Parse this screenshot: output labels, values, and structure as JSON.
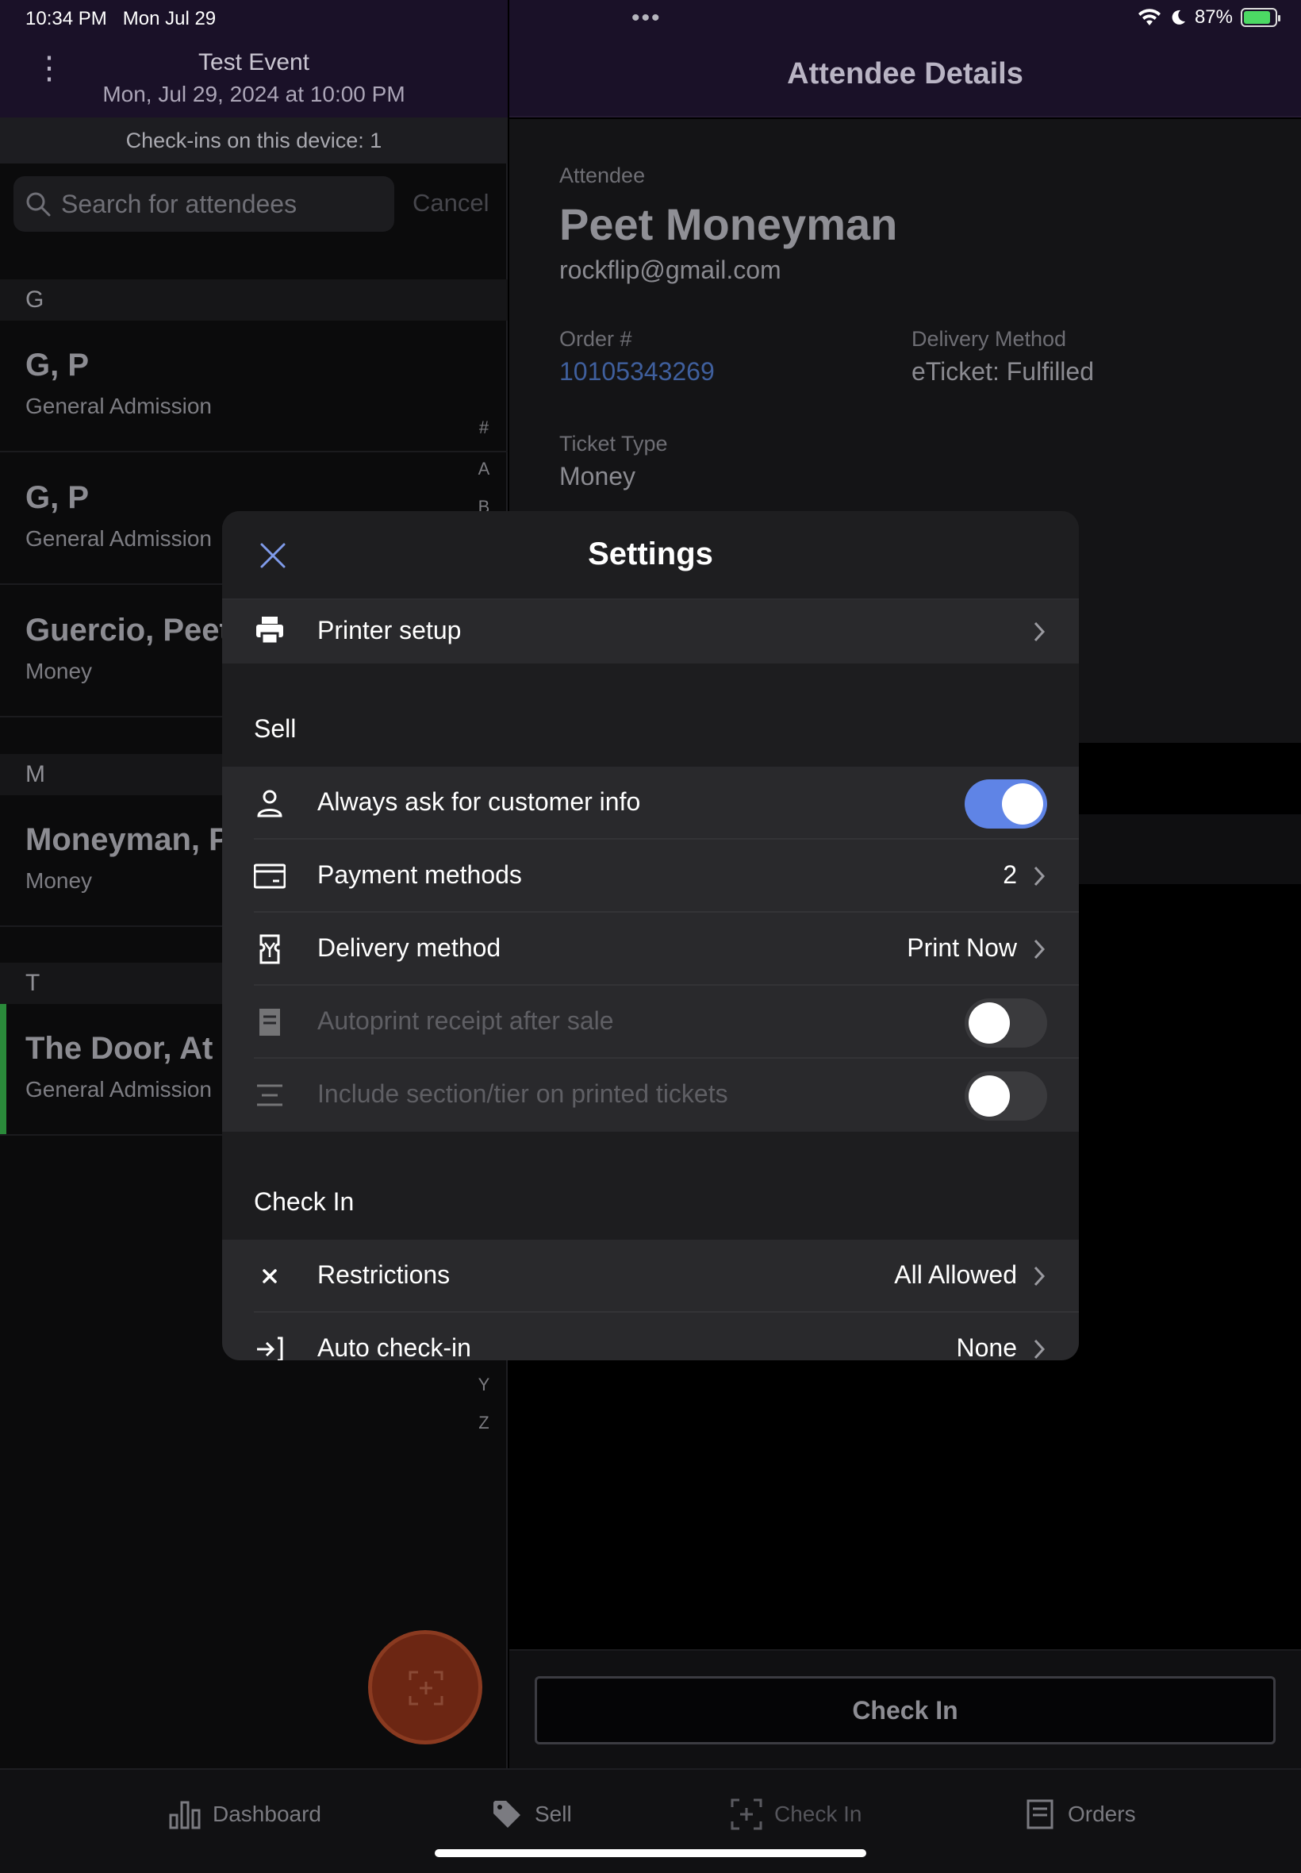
{
  "status_bar": {
    "time": "10:34 PM",
    "date": "Mon Jul 29",
    "dots": "•••",
    "battery": "87%",
    "battery_level": 0.87,
    "icons": [
      "wifi-icon",
      "moon-icon",
      "battery-charging-icon"
    ]
  },
  "event": {
    "title": "Test Event",
    "date": "Mon, Jul 29, 2024 at 10:00 PM",
    "checkins": "Check-ins on this device: 1"
  },
  "search": {
    "placeholder": "Search for attendees",
    "cancel": "Cancel"
  },
  "attendee_list": {
    "sections": [
      "G",
      "M",
      "T"
    ],
    "items": [
      {
        "name": "G, P",
        "ticket": "General Admission"
      },
      {
        "name": "G, P",
        "ticket": "General Admission"
      },
      {
        "name": "Guercio, Peet",
        "ticket": "Money"
      },
      {
        "name": "Moneyman, Pe",
        "ticket": "Money"
      },
      {
        "name": "The Door, At",
        "ticket": "General Admission"
      }
    ],
    "index_visible": [
      "#",
      "A",
      "B",
      "Y",
      "Z"
    ]
  },
  "details": {
    "header": "Attendee Details",
    "attendee_label": "Attendee",
    "name": "Peet Moneyman",
    "email": "rockflip@gmail.com",
    "order_label": "Order #",
    "order_number": "10105343269",
    "delivery_label": "Delivery Method",
    "delivery_value": "eTicket: Fulfilled",
    "ticket_type_label": "Ticket Type",
    "ticket_type_value": "Money",
    "check_in_button": "Check In"
  },
  "tabs": [
    {
      "label": "Dashboard",
      "icon": "bar-chart-icon"
    },
    {
      "label": "Sell",
      "icon": "tag-icon"
    },
    {
      "label": "Check In",
      "icon": "scan-icon"
    },
    {
      "label": "Orders",
      "icon": "orders-icon"
    }
  ],
  "settings_modal": {
    "title": "Settings",
    "printer_setup": "Printer setup",
    "sell_section": "Sell",
    "sell_rows": [
      {
        "label": "Always ask for customer info",
        "icon": "person-icon",
        "toggle": true,
        "enabled": true
      },
      {
        "label": "Payment methods",
        "icon": "credit-card-icon",
        "value": "2"
      },
      {
        "label": "Delivery method",
        "icon": "ticket-icon",
        "value": "Print Now"
      },
      {
        "label": "Autoprint receipt after sale",
        "icon": "receipt-icon",
        "toggle": false,
        "enabled": false
      },
      {
        "label": "Include section/tier on printed tickets",
        "icon": "list-lines-icon",
        "toggle": false,
        "enabled": false
      }
    ],
    "checkin_section": "Check In",
    "checkin_rows": [
      {
        "label": "Restrictions",
        "icon": "x-icon",
        "value": "All Allowed"
      },
      {
        "label": "Auto check-in",
        "icon": "enter-icon",
        "value": "None"
      }
    ]
  },
  "colors": {
    "header_bg": "#1a1128",
    "toggle_on": "#5f84e6",
    "link": "#3f5f9d",
    "fab": "#6c2613",
    "checked_bar": "#2a8a3a"
  }
}
